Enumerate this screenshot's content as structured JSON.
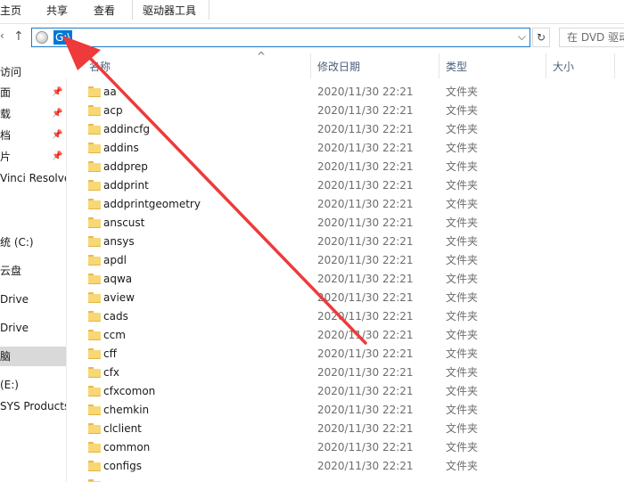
{
  "ribbon": {
    "tabs": [
      "主页",
      "共享",
      "查看",
      "驱动器工具"
    ]
  },
  "address": {
    "path": "G:\\",
    "chevron": "⌵",
    "refresh": "↻",
    "search_placeholder": "在 DVD 驱动"
  },
  "nav": {
    "back_arrow": "‹",
    "up_arrow": "↑"
  },
  "sidebar": {
    "items": [
      {
        "label": "访问",
        "pinned": false
      },
      {
        "label": "面",
        "pinned": true
      },
      {
        "label": "载",
        "pinned": true
      },
      {
        "label": "档",
        "pinned": true
      },
      {
        "label": "片",
        "pinned": true
      },
      {
        "label": "Vinci Resolve",
        "pinned": false
      },
      {
        "label": "统 (C:)",
        "pinned": false
      },
      {
        "label": "云盘",
        "pinned": false
      },
      {
        "label": "Drive",
        "pinned": false
      },
      {
        "label": "Drive",
        "pinned": false
      },
      {
        "label": "脑",
        "pinned": false,
        "selected": true
      },
      {
        "label": " (E:)",
        "pinned": false
      },
      {
        "label": "SYS Products",
        "pinned": false
      }
    ],
    "pin_glyph": "📌"
  },
  "columns": {
    "name": "名称",
    "modified": "修改日期",
    "type": "类型",
    "size": "大小"
  },
  "files": [
    {
      "name": "aa",
      "date": "2020/11/30 22:21",
      "type": "文件夹"
    },
    {
      "name": "acp",
      "date": "2020/11/30 22:21",
      "type": "文件夹"
    },
    {
      "name": "addincfg",
      "date": "2020/11/30 22:21",
      "type": "文件夹"
    },
    {
      "name": "addins",
      "date": "2020/11/30 22:21",
      "type": "文件夹"
    },
    {
      "name": "addprep",
      "date": "2020/11/30 22:21",
      "type": "文件夹"
    },
    {
      "name": "addprint",
      "date": "2020/11/30 22:21",
      "type": "文件夹"
    },
    {
      "name": "addprintgeometry",
      "date": "2020/11/30 22:21",
      "type": "文件夹"
    },
    {
      "name": "anscust",
      "date": "2020/11/30 22:21",
      "type": "文件夹"
    },
    {
      "name": "ansys",
      "date": "2020/11/30 22:21",
      "type": "文件夹"
    },
    {
      "name": "apdl",
      "date": "2020/11/30 22:21",
      "type": "文件夹"
    },
    {
      "name": "aqwa",
      "date": "2020/11/30 22:21",
      "type": "文件夹"
    },
    {
      "name": "aview",
      "date": "2020/11/30 22:21",
      "type": "文件夹"
    },
    {
      "name": "cads",
      "date": "2020/11/30 22:21",
      "type": "文件夹"
    },
    {
      "name": "ccm",
      "date": "2020/11/30 22:21",
      "type": "文件夹"
    },
    {
      "name": "cff",
      "date": "2020/11/30 22:21",
      "type": "文件夹"
    },
    {
      "name": "cfx",
      "date": "2020/11/30 22:21",
      "type": "文件夹"
    },
    {
      "name": "cfxcomon",
      "date": "2020/11/30 22:21",
      "type": "文件夹"
    },
    {
      "name": "chemkin",
      "date": "2020/11/30 22:21",
      "type": "文件夹"
    },
    {
      "name": "clclient",
      "date": "2020/11/30 22:21",
      "type": "文件夹"
    },
    {
      "name": "common",
      "date": "2020/11/30 22:21",
      "type": "文件夹"
    },
    {
      "name": "configs",
      "date": "2020/11/30 22:21",
      "type": "文件夹"
    },
    {
      "name": "",
      "date": "",
      "type": ""
    }
  ],
  "colors": {
    "accent": "#0078d7",
    "annotation_arrow": "#ee3a3a",
    "folder": "#f8d775",
    "selected_nav": "#d9d9d9"
  }
}
